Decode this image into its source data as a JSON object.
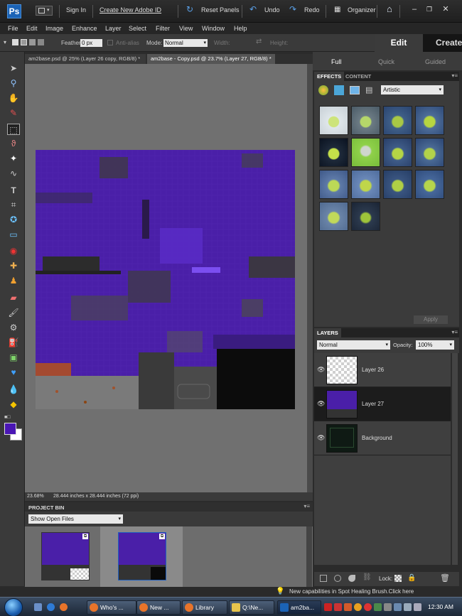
{
  "topbar": {
    "sign_in": "Sign In",
    "create_id": "Create New Adobe ID",
    "reset_panels": "Reset Panels",
    "undo": "Undo",
    "redo": "Redo",
    "organizer": "Organizer"
  },
  "menu": [
    "File",
    "Edit",
    "Image",
    "Enhance",
    "Layer",
    "Select",
    "Filter",
    "View",
    "Window",
    "Help"
  ],
  "options": {
    "feather_label": "Feather:",
    "feather_value": "0 px",
    "anti_alias": "Anti-alias",
    "mode_label": "Mode:",
    "mode_value": "Normal",
    "width_label": "Width:",
    "height_label": "Height:"
  },
  "mode_tabs": {
    "edit": "Edit",
    "create": "Create"
  },
  "sub_tabs": {
    "full": "Full",
    "quick": "Quick",
    "guided": "Guided"
  },
  "doc_tabs": [
    "am2base.psd @ 25% (Layer 26 copy, RGB/8) *",
    "am2base - Copy.psd @ 23.7% (Layer 27, RGB/8) *"
  ],
  "canvas_status": {
    "zoom": "23.68%",
    "size": "28.444 inches x 28.444 inches (72 ppi)"
  },
  "project_bin": {
    "title": "PROJECT BIN",
    "show": "Show Open Files"
  },
  "effects": {
    "tab_effects": "EFFECTS",
    "tab_content": "CONTENT",
    "category": "Artistic",
    "apply": "Apply"
  },
  "layers": {
    "title": "LAYERS",
    "blend": "Normal",
    "opacity_label": "Opacity:",
    "opacity_value": "100%",
    "lock_label": "Lock:",
    "items": [
      "Layer 26",
      "Layer 27",
      "Background"
    ]
  },
  "tip": "New capabilities in Spot Healing Brush.Click here",
  "taskbar": {
    "buttons": [
      "Who's ...",
      "New ...",
      "Library",
      "Q:\\Ne...",
      "am2ba..."
    ],
    "clock": "12:30 AM"
  },
  "colors": {
    "accent_purple": "#4a1fa8",
    "foreground_swatch": "#4a16b4",
    "background_swatch": "#ffffff",
    "selected_layer": "#1c1c1c"
  }
}
